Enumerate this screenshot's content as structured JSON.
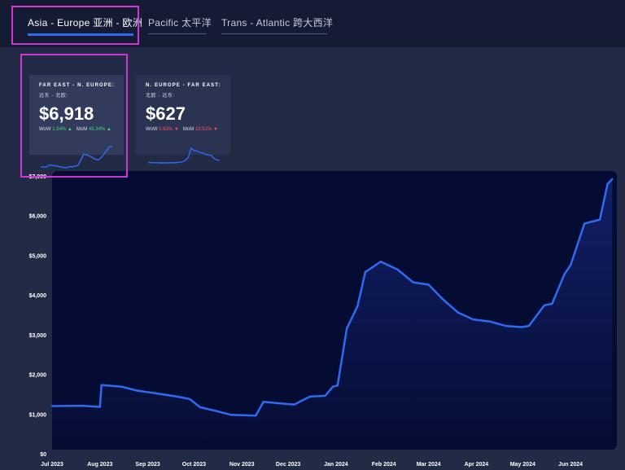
{
  "tabs": [
    {
      "label": "Asia - Europe  亚洲 - 欧洲",
      "active": true
    },
    {
      "label": "Pacific  太平洋",
      "active": false
    },
    {
      "label": "Trans - Atlantic  跨大西洋",
      "active": false
    }
  ],
  "cards": [
    {
      "route": "FAR EAST - N. EUROPE:",
      "route_cn": "远东 - 北欧:",
      "price": "$6,918",
      "wow_label": "WoW",
      "wow_value": "1.54%",
      "wow_arrow": "▲",
      "mom_label": "MoM",
      "mom_value": "45.34%",
      "mom_arrow": "▲",
      "spark": [
        1200,
        1180,
        1170,
        1730,
        1700,
        1560,
        1420,
        1200,
        1080,
        980,
        1300,
        1260,
        1450,
        1650,
        3150,
        4800,
        4600,
        4300,
        3900,
        3380,
        3220,
        3700,
        4750,
        5800,
        6900,
        6918
      ]
    },
    {
      "route": "N. EUROPE - FAR EAST:",
      "route_cn": "北欧 - 远东:",
      "price": "$627",
      "wow_label": "WoW",
      "wow_value": "0.63%",
      "wow_arrow": "▼",
      "mom_label": "MoM",
      "mom_value": "19.51%",
      "mom_arrow": "▼",
      "spark": [
        560,
        555,
        550,
        552,
        548,
        545,
        550,
        548,
        552,
        545,
        560,
        565,
        580,
        620,
        700,
        980,
        920,
        900,
        860,
        840,
        800,
        780,
        770,
        680,
        627,
        627
      ]
    }
  ],
  "chart_data": {
    "type": "area",
    "x": [
      "2023-07-01",
      "2023-07-20",
      "2023-08-01",
      "2023-08-02",
      "2023-08-15",
      "2023-08-25",
      "2023-09-05",
      "2023-09-20",
      "2023-09-28",
      "2023-10-05",
      "2023-10-15",
      "2023-10-25",
      "2023-11-10",
      "2023-11-15",
      "2023-11-25",
      "2023-12-05",
      "2023-12-15",
      "2023-12-25",
      "2023-12-30",
      "2024-01-02",
      "2024-01-08",
      "2024-01-15",
      "2024-01-20",
      "2024-01-30",
      "2024-02-10",
      "2024-02-20",
      "2024-03-01",
      "2024-03-10",
      "2024-03-20",
      "2024-03-30",
      "2024-04-10",
      "2024-04-20",
      "2024-04-30",
      "2024-05-05",
      "2024-05-15",
      "2024-05-20",
      "2024-05-28",
      "2024-06-01",
      "2024-06-10",
      "2024-06-20",
      "2024-06-25",
      "2024-06-28"
    ],
    "values": [
      1200,
      1210,
      1180,
      1730,
      1690,
      1590,
      1530,
      1440,
      1380,
      1170,
      1080,
      980,
      960,
      1310,
      1270,
      1240,
      1440,
      1460,
      1690,
      1720,
      3160,
      3720,
      4580,
      4840,
      4640,
      4320,
      4260,
      3900,
      3560,
      3380,
      3330,
      3220,
      3190,
      3220,
      3740,
      3780,
      4520,
      4750,
      5800,
      5900,
      6800,
      6918
    ],
    "ylim": [
      0,
      7000
    ],
    "yticks": [
      0,
      1000,
      2000,
      3000,
      4000,
      5000,
      6000,
      7000
    ],
    "ytick_labels": [
      "$0",
      "$1,000",
      "$2,000",
      "$3,000",
      "$4,000",
      "$5,000",
      "$6,000",
      "$7,000"
    ],
    "xticks": [
      "2023-07-01",
      "2023-08-01",
      "2023-09-01",
      "2023-10-01",
      "2023-11-01",
      "2023-12-01",
      "2024-01-01",
      "2024-02-01",
      "2024-03-01",
      "2024-04-01",
      "2024-05-01",
      "2024-06-01"
    ],
    "xtick_labels": [
      "Jul 2023",
      "Aug 2023",
      "Sep 2023",
      "Oct 2023",
      "Nov 2023",
      "Dec 2023",
      "Jan 2024",
      "Feb 2024",
      "Mar 2024",
      "Apr 2024",
      "May 2024",
      "Jun 2024"
    ],
    "xlim": [
      "2023-07-01",
      "2024-07-01"
    ],
    "grid": false,
    "line_color": "#2e6bf0",
    "plot_background": "#050c33"
  },
  "colors": {
    "accent": "#2e6bf0",
    "highlight": "#d036d6",
    "positive": "#41d67a",
    "negative": "#ff4d5e"
  }
}
